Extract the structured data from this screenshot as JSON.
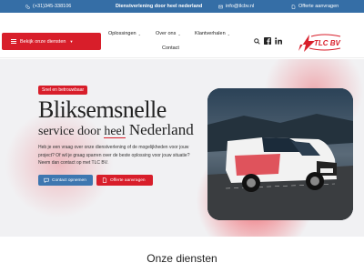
{
  "topbar": {
    "phone": "(+31)345-338106",
    "slogan": "Dienstverlening door heel nederland",
    "email": "info@tlcbv.nl",
    "quote": "Offerte aanvragen"
  },
  "header": {
    "services_button": "Bekijk onze diensten",
    "nav": [
      {
        "label": "Oplossingen"
      },
      {
        "label": "Over ons"
      },
      {
        "label": "Klantverhalen"
      },
      {
        "label": "Contact"
      }
    ],
    "logo_text": "TLC BV"
  },
  "hero": {
    "tag": "Snel en betrouwbaar",
    "title": "Bliksemsnelle",
    "subtitle_pre": "service door ",
    "subtitle_heel": "heel",
    "subtitle_post": " Nederland",
    "lead": "Heb je een vraag over onze dienstverlening of de mogelijkheden voor jouw project? Of wil je graag sparren over de beste oplossing voor jouw situatie? Neem dan contact op met TLC BV.",
    "contact_button": "Contact opnemen",
    "offer_button": "Offerte aanvragen"
  },
  "services": {
    "title": "Onze diensten"
  },
  "colors": {
    "topbar": "#356ea6",
    "accent": "#d81e2a",
    "secondary_button": "#3e77b0"
  }
}
